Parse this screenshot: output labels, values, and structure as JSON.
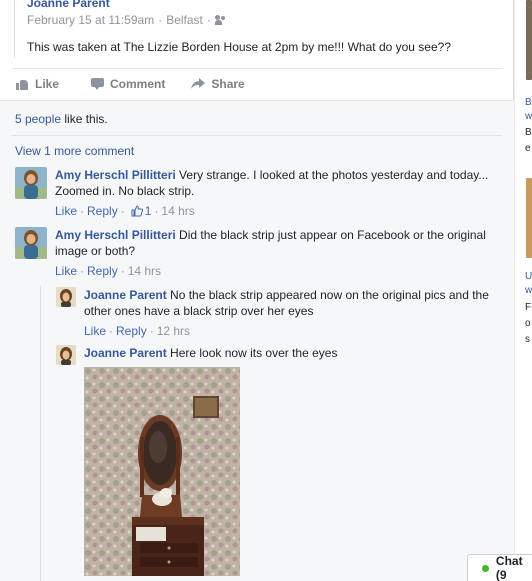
{
  "post": {
    "author": "Joanne Parent",
    "date": "February 15 at 11:59am",
    "location": "Belfast",
    "audience_icon": "friends-icon",
    "text": "This was taken at The Lizzie Borden House at 2pm by me!!! What do you see??"
  },
  "actions": {
    "like": "Like",
    "comment": "Comment",
    "share": "Share"
  },
  "likes": {
    "people_link": "5 people",
    "suffix": " like this."
  },
  "view_more": "View 1 more comment",
  "comments": [
    {
      "name": "Amy Herschl Pillitteri",
      "text": " Very strange. I looked at the photos yesterday and today... Zoomed in. No black strip.",
      "like": "Like",
      "reply": "Reply",
      "reactions": "1",
      "time": "14 hrs"
    },
    {
      "name": "Amy Herschl Pillitteri",
      "text": " Did the black strip just appear on Facebook or the original image or both?",
      "like": "Like",
      "reply": "Reply",
      "time": "14 hrs"
    }
  ],
  "replies": [
    {
      "name": "Joanne Parent",
      "text": " No the black strip appeared now on the original pics and the other ones have a black strip over her eyes",
      "like": "Like",
      "reply": "Reply",
      "time": "12 hrs"
    },
    {
      "name": "Joanne Parent",
      "text": " Here look now its over the eyes"
    }
  ],
  "sidebar": {
    "letters": [
      "B",
      "w",
      "B",
      "e",
      "U",
      "w",
      "F",
      "o",
      "o",
      "s"
    ]
  },
  "chat": {
    "label": "Chat (9"
  },
  "colors": {
    "link": "#365899",
    "meta": "#90949c",
    "online": "#42b72a"
  }
}
